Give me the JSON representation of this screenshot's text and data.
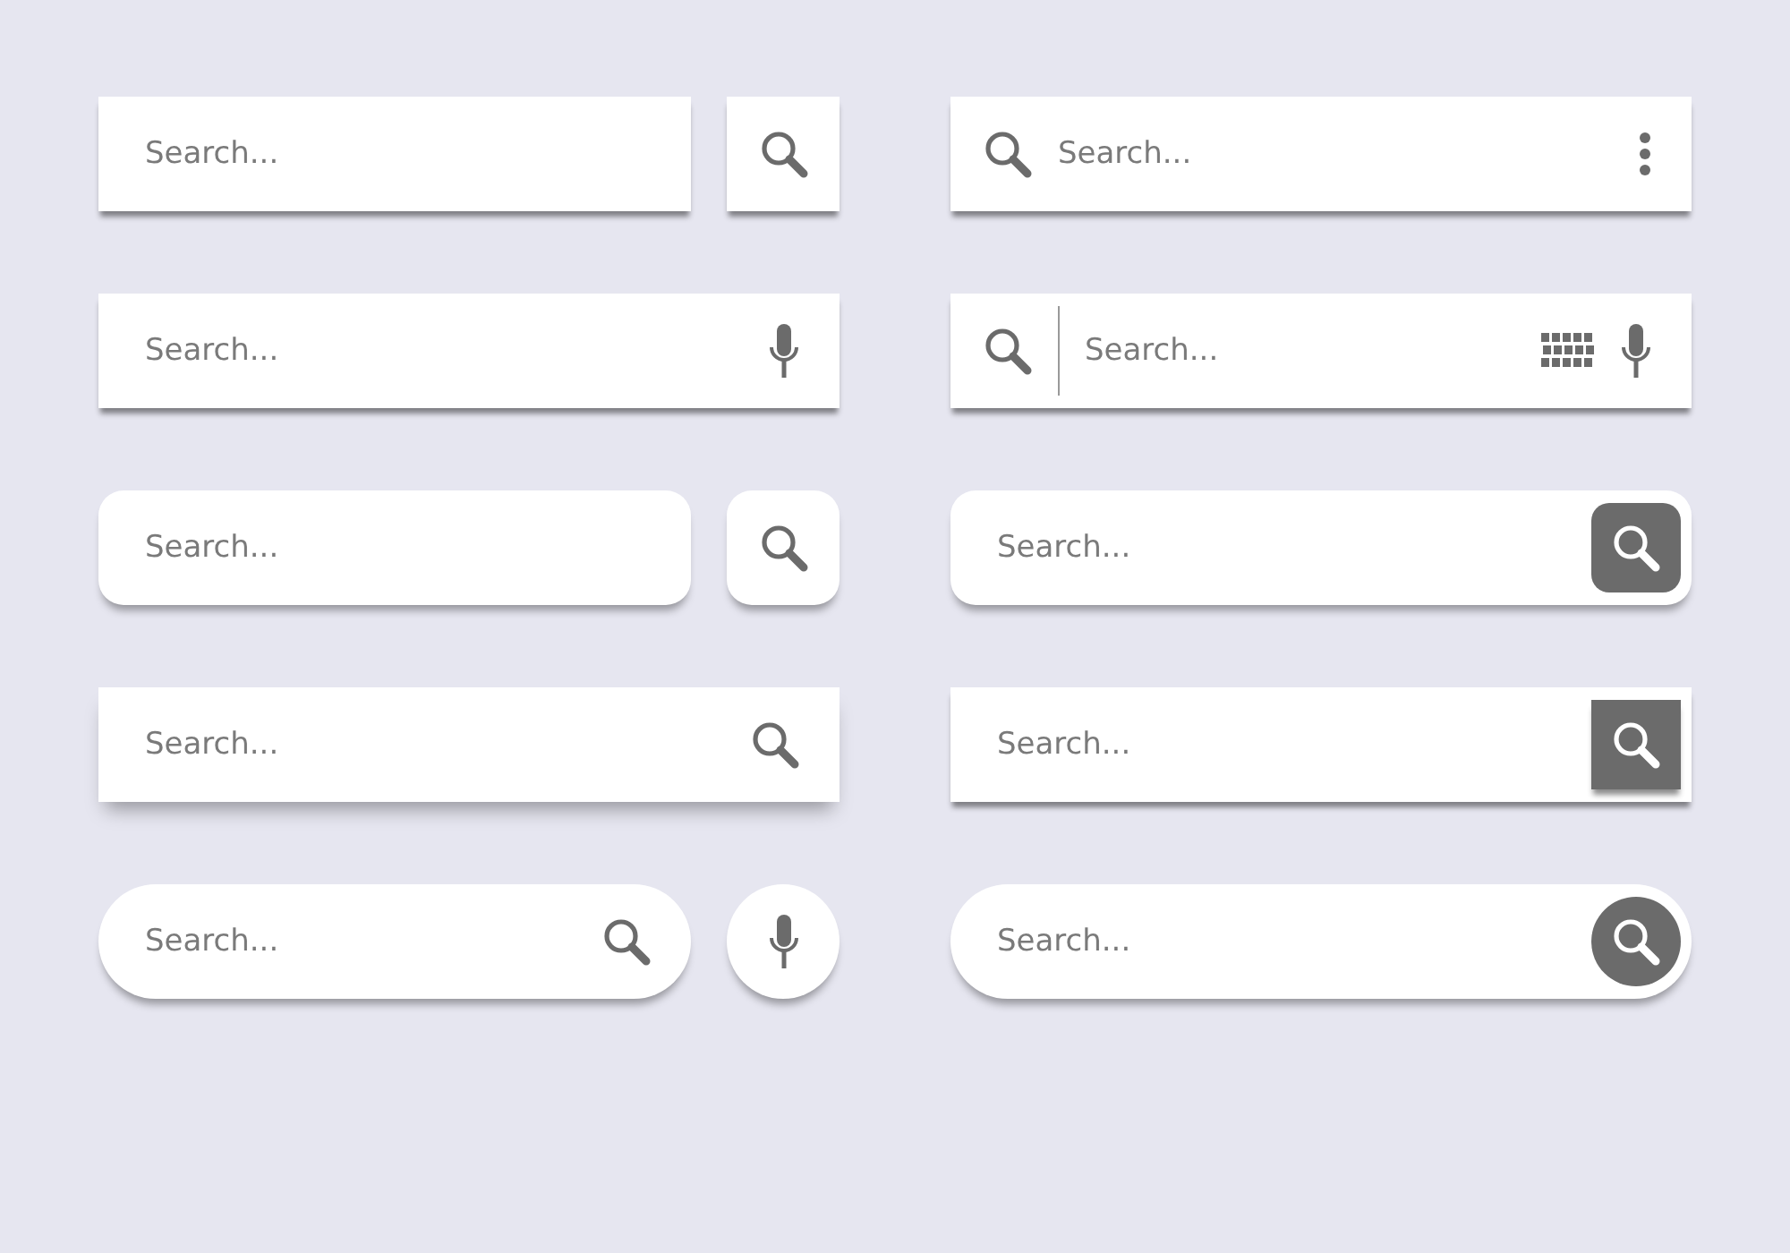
{
  "bars": [
    {
      "kind": "plain",
      "placeholder": "Search..."
    },
    {
      "kind": "menu",
      "placeholder": "Search..."
    },
    {
      "kind": "voice",
      "placeholder": "Search..."
    },
    {
      "kind": "keyboard",
      "placeholder": "Search..."
    },
    {
      "kind": "rounded",
      "placeholder": "Search..."
    },
    {
      "kind": "roundedbutton",
      "placeholder": "Search..."
    },
    {
      "kind": "soft",
      "placeholder": "Search..."
    },
    {
      "kind": "squarebutton",
      "placeholder": "Search..."
    },
    {
      "kind": "pill",
      "placeholder": "Search..."
    },
    {
      "kind": "pillbutton",
      "placeholder": "Search..."
    }
  ]
}
